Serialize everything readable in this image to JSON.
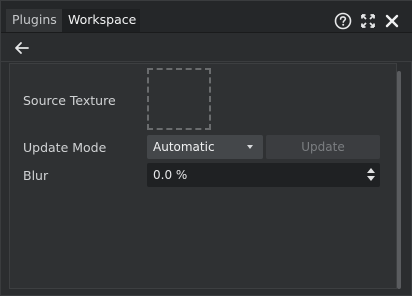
{
  "tabs": [
    {
      "label": "Plugins",
      "active": false
    },
    {
      "label": "Workspace",
      "active": true
    }
  ],
  "window_icons": [
    "help-icon",
    "expand-icon",
    "close-icon"
  ],
  "nav": {
    "back_icon": "arrow-left-icon"
  },
  "form": {
    "source_texture": {
      "label": "Source Texture"
    },
    "update_mode": {
      "label": "Update Mode",
      "value": "Automatic"
    },
    "update_button": {
      "label": "Update",
      "enabled": false
    },
    "blur": {
      "label": "Blur",
      "value": "0.0 %"
    }
  },
  "colors": {
    "background": "#2b2d2f",
    "panel": "#2f3133",
    "active_tab": "#1e2022",
    "select_bg": "#44474a",
    "field_bg": "#1f2123",
    "disabled_text": "#7b7e81"
  }
}
